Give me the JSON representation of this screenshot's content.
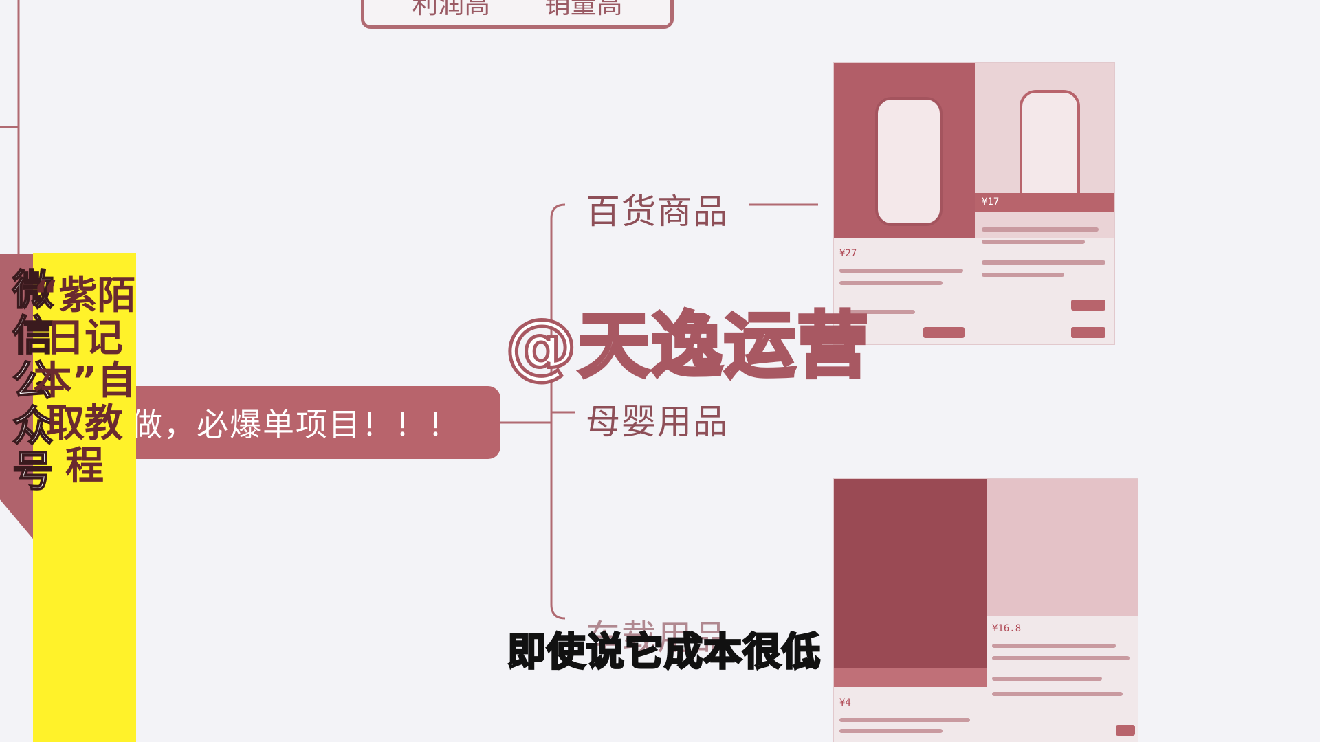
{
  "mindmap": {
    "top_node": {
      "left_label": "利润高",
      "right_label": "销量高"
    },
    "center_node": "做，必爆单项目！！！",
    "branches": [
      "百货商品",
      "母婴用品",
      "车载用品"
    ]
  },
  "banner": {
    "vertical_text": "微信公众号",
    "promo_text": "“紫陌日记本”自取教程"
  },
  "watermark": "@天逸运营",
  "subtitle": "即使说它成本很低",
  "product_cards": {
    "card1": {
      "price_main": "¥27",
      "price_side": "¥17"
    },
    "card2": {
      "price_main": "¥16.8",
      "price_side": "¥4"
    }
  },
  "colors": {
    "brand": "#b8646c",
    "banner_yellow": "#fff22a",
    "background": "#f3f3f7"
  }
}
